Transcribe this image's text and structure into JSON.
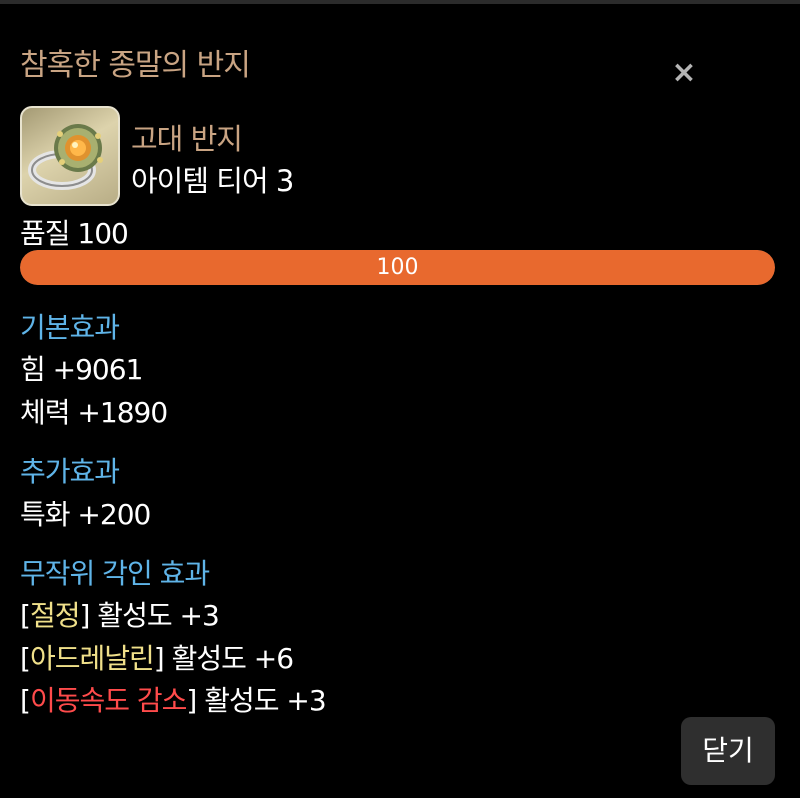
{
  "dialog": {
    "title": "참혹한 종말의 반지",
    "close_icon": "×",
    "close_button": "닫기"
  },
  "item": {
    "icon": "ring-icon",
    "grade": "고대 반지",
    "tier": "아이템 티어 3",
    "quality_label": "품질 100",
    "quality_value": "100",
    "quality_fraction": 1.0,
    "quality_color": "#e8692e"
  },
  "basic_effects": {
    "header": "기본효과",
    "lines": [
      "힘 +9061",
      "체력 +1890"
    ]
  },
  "extra_effects": {
    "header": "추가효과",
    "lines": [
      "특화 +200"
    ]
  },
  "engravings": {
    "header": "무작위 각인 효과",
    "items": [
      {
        "open": "[",
        "name": "절정",
        "close": "]",
        "suffix": " 활성도 +3",
        "color": "#f0e08a"
      },
      {
        "open": "[",
        "name": "아드레날린",
        "close": "]",
        "suffix": " 활성도 +6",
        "color": "#f0e08a"
      },
      {
        "open": "[",
        "name": "이동속도 감소",
        "close": "]",
        "suffix": " 활성도 +3",
        "color": "#ff4b4b"
      }
    ]
  },
  "colors": {
    "section_header": "#5fb4e8",
    "title": "#c9a483",
    "positive_engraving": "#f0e08a",
    "negative_engraving": "#ff4b4b"
  }
}
